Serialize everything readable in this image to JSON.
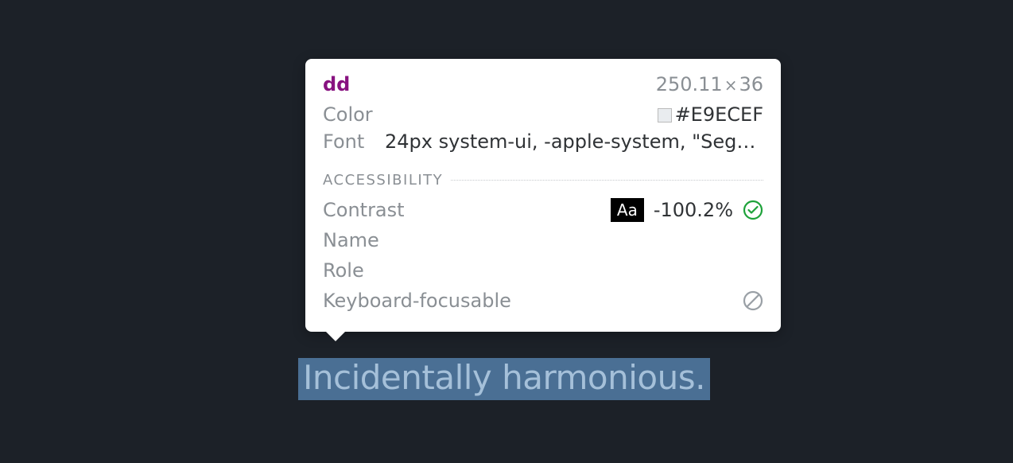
{
  "highlighted": {
    "text": "Incidentally harmonious."
  },
  "tooltip": {
    "tag": "dd",
    "dimensions_w": "250.11",
    "dimensions_h": "36",
    "color_label": "Color",
    "color_value": "#E9ECEF",
    "font_label": "Font",
    "font_value": "24px system-ui, -apple-system, \"Segoe…",
    "accessibility": {
      "header": "ACCESSIBILITY",
      "contrast_label": "Contrast",
      "contrast_badge": "Aa",
      "contrast_value": "-100.2%",
      "name_label": "Name",
      "role_label": "Role",
      "keyboard_label": "Keyboard-focusable"
    }
  }
}
